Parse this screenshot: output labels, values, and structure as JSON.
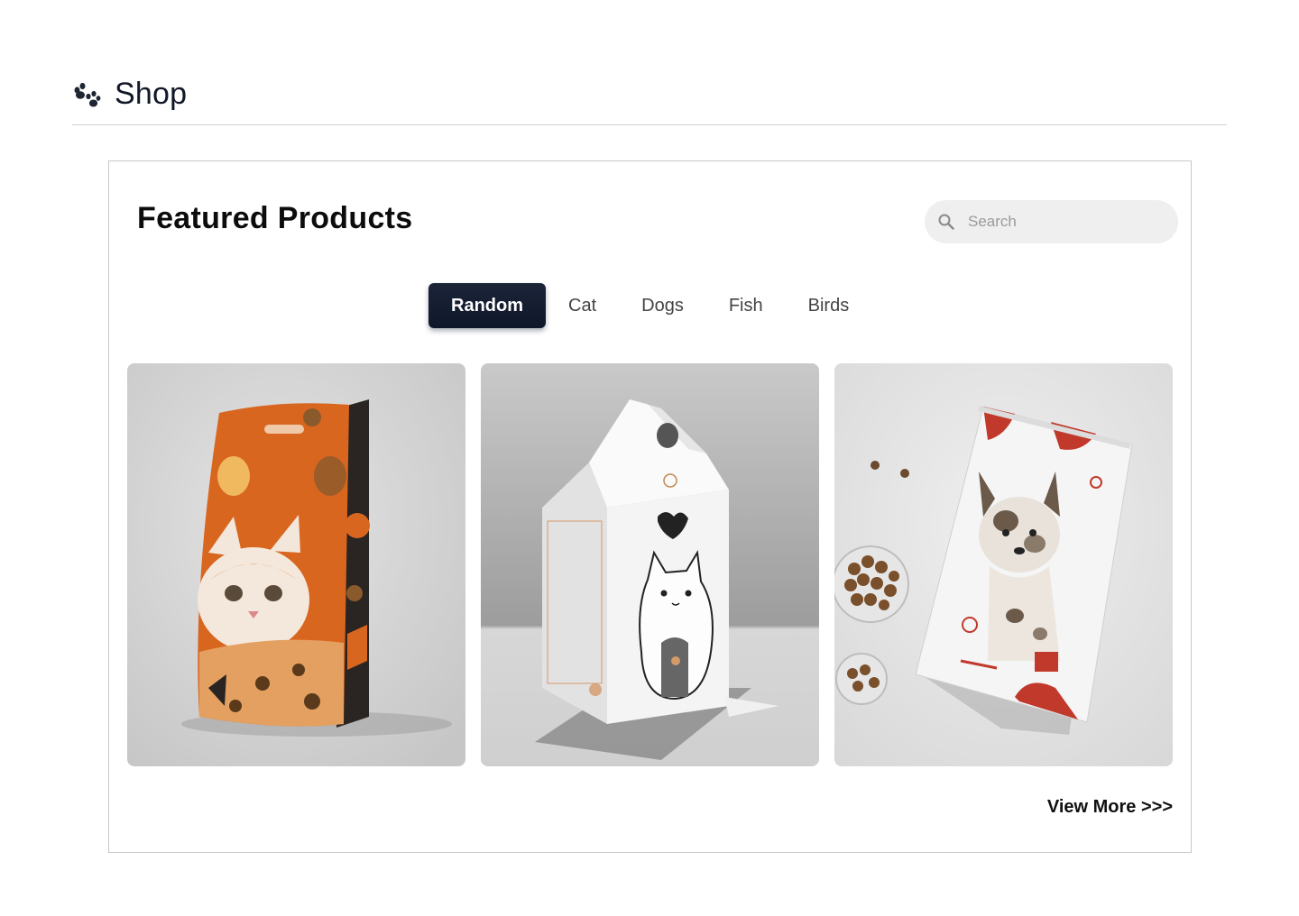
{
  "header": {
    "icon": "paw-icon",
    "title": "Shop"
  },
  "featured": {
    "title": "Featured Products",
    "search": {
      "placeholder": "Search",
      "value": "",
      "icon": "search-icon"
    },
    "tabs": [
      {
        "label": "Random",
        "active": true
      },
      {
        "label": "Cat",
        "active": false
      },
      {
        "label": "Dogs",
        "active": false
      },
      {
        "label": "Fish",
        "active": false
      },
      {
        "label": "Birds",
        "active": false
      }
    ],
    "products": [
      {
        "image": "orange-cat-food-pouch"
      },
      {
        "image": "white-cat-food-box"
      },
      {
        "image": "dog-food-pouch-with-kibble"
      }
    ],
    "view_more": "View More >>>"
  },
  "colors": {
    "active_tab": "#111827",
    "search_bg": "#efefef",
    "accent_orange": "#d9661f",
    "accent_red": "#c0392b"
  }
}
